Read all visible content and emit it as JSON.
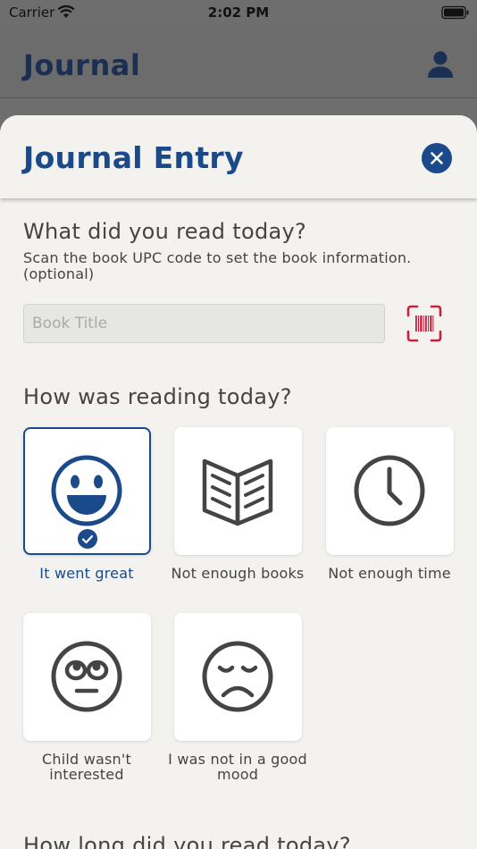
{
  "status_bar": {
    "carrier": "Carrier",
    "time": "2:02 PM"
  },
  "app_header": {
    "title": "Journal",
    "profile_icon": "person-icon"
  },
  "sheet": {
    "title": "Journal Entry",
    "close_icon": "close-icon",
    "book_section": {
      "heading": "What did you read today?",
      "helper": "Scan the book UPC code to set the book information. (optional)",
      "input_value": "",
      "input_placeholder": "Book Title",
      "scan_icon": "barcode-scan-icon"
    },
    "reading_section": {
      "heading": "How was reading today?",
      "options": [
        {
          "label": "It went great",
          "icon": "happy-face-icon",
          "selected": true
        },
        {
          "label": "Not enough books",
          "icon": "open-book-icon",
          "selected": false
        },
        {
          "label": "Not enough time",
          "icon": "clock-icon",
          "selected": false
        },
        {
          "label": "Child wasn't interested",
          "icon": "eye-roll-face-icon",
          "selected": false
        },
        {
          "label": "I was not in a good mood",
          "icon": "sad-face-icon",
          "selected": false
        }
      ]
    },
    "duration_section": {
      "heading": "How long did you read today?"
    }
  },
  "colors": {
    "brand_blue": "#1b4a8a",
    "header_navy": "#1a2f52",
    "scan_red": "#c8203f",
    "icon_gray": "#444444",
    "sheet_bg": "#f3f2ef"
  }
}
